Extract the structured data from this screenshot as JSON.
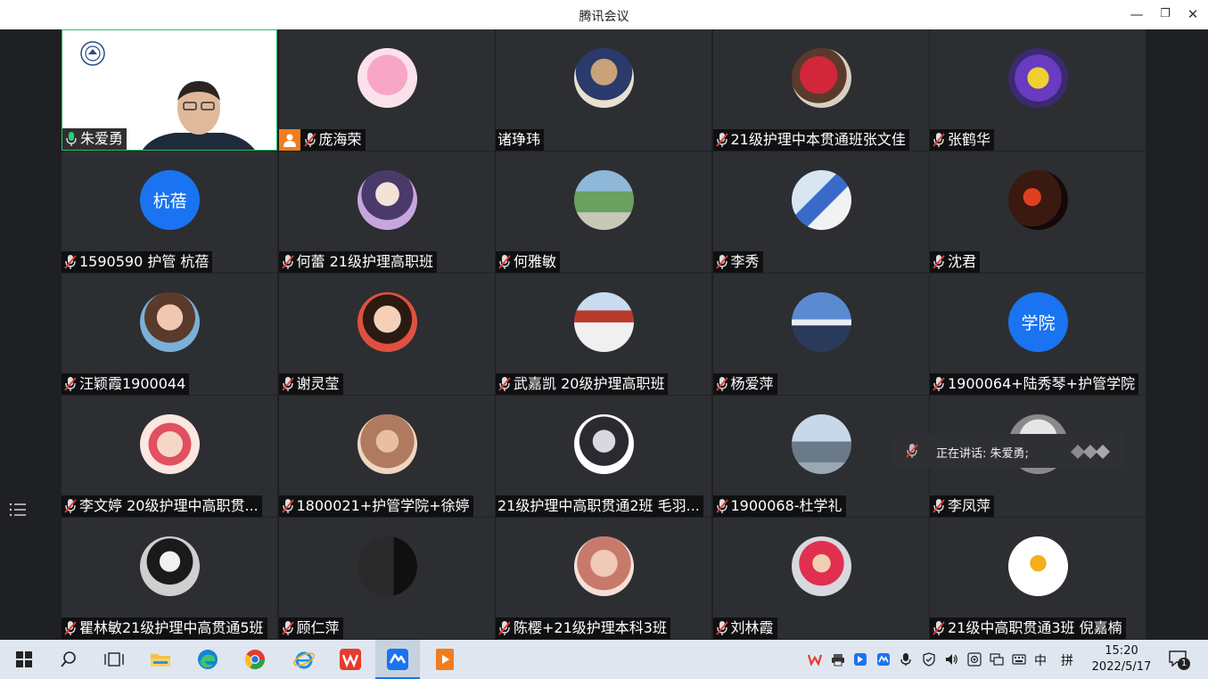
{
  "window": {
    "title": "腾讯会议",
    "minimize": "—",
    "restore": "❐",
    "close": "✕"
  },
  "participants": [
    {
      "name": "朱爱勇",
      "mic": "on",
      "active": true
    },
    {
      "name": "庞海荣",
      "mic": "off",
      "host": true
    },
    {
      "name": "诸琤玮",
      "mic": "none"
    },
    {
      "name": "21级护理中本贯通班张文佳",
      "mic": "off"
    },
    {
      "name": "张鹤华",
      "mic": "off"
    },
    {
      "name": "1590590 护管 杭蓓",
      "mic": "off",
      "avatar_text": "杭蓓"
    },
    {
      "name": "何蕾 21级护理高职班",
      "mic": "off"
    },
    {
      "name": "何雅敏",
      "mic": "off"
    },
    {
      "name": "李秀",
      "mic": "off"
    },
    {
      "name": "沈君",
      "mic": "off"
    },
    {
      "name": "汪颖霞1900044",
      "mic": "off"
    },
    {
      "name": "谢灵莹",
      "mic": "off"
    },
    {
      "name": "武嘉凯 20级护理高职班",
      "mic": "off"
    },
    {
      "name": "杨爱萍",
      "mic": "off"
    },
    {
      "name": "1900064+陆秀琴+护管学院",
      "mic": "off",
      "avatar_text": "学院"
    },
    {
      "name": "李文婷 20级护理中高职贯...",
      "mic": "off"
    },
    {
      "name": "1800021+护管学院+徐婷",
      "mic": "off"
    },
    {
      "name": "21级护理中高职贯通2班 毛羽...",
      "mic": "none"
    },
    {
      "name": "1900068-杜学礼",
      "mic": "off"
    },
    {
      "name": "李凤萍",
      "mic": "off"
    },
    {
      "name": "瞿林敏21级护理中高贯通5班",
      "mic": "off"
    },
    {
      "name": "顾仁萍",
      "mic": "off"
    },
    {
      "name": "陈樱+21级护理本科3班",
      "mic": "off"
    },
    {
      "name": "刘林霞",
      "mic": "off"
    },
    {
      "name": "21级中高职贯通3班 倪嘉楠",
      "mic": "off"
    }
  ],
  "speaker_toast": {
    "label": "正在讲话: 朱爱勇;"
  },
  "taskbar": {
    "ime_lang": "中",
    "ime_mode": "拼",
    "time": "15:20",
    "date": "2022/5/17",
    "notifications": "1"
  },
  "colors": {
    "accent": "#1a73f0",
    "active_border": "#27c26b",
    "host": "#f07d1f",
    "mute": "#e53935"
  },
  "icons": [
    "windows-start-icon",
    "search-icon",
    "task-view-icon",
    "file-explorer-icon",
    "edge-icon",
    "chrome-icon",
    "ie-icon",
    "wps-icon",
    "tencent-meeting-icon",
    "player-icon"
  ]
}
